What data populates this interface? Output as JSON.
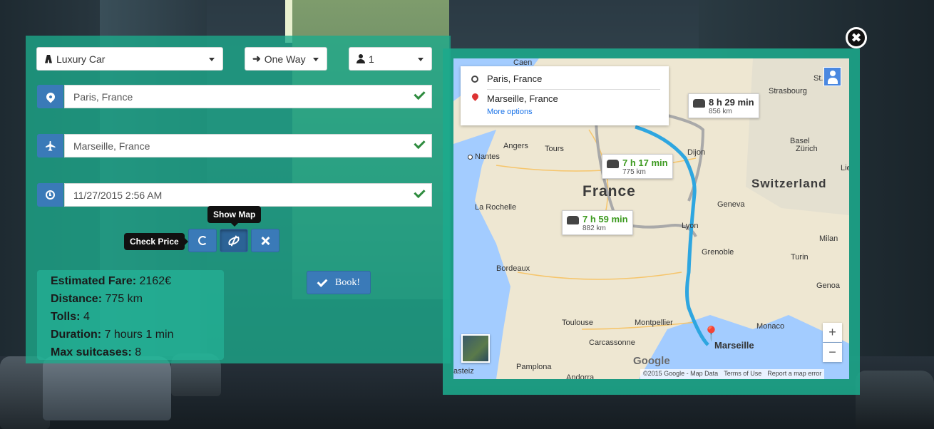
{
  "form": {
    "vehicle": "Luxury Car",
    "trip_type": "One Way",
    "passengers": "1",
    "pickup": "Paris, France",
    "dropoff": "Marseille, France",
    "datetime": "11/27/2015 2:56 AM"
  },
  "tooltips": {
    "show_map": "Show Map",
    "check_price": "Check Price"
  },
  "summary": {
    "fare_label": "Estimated Fare:",
    "fare_value": "2162€",
    "distance_label": "Distance:",
    "distance_value": "775 km",
    "tolls_label": "Tolls:",
    "tolls_value": "4",
    "duration_label": "Duration:",
    "duration_value": "7 hours 1 min",
    "suitcases_label": "Max suitcases:",
    "suitcases_value": "8"
  },
  "book_label": "Book!",
  "map": {
    "origin": "Paris, France",
    "destination": "Marseille, France",
    "more_options": "More options",
    "routes": [
      {
        "time": "8 h 29 min",
        "distance": "856 km"
      },
      {
        "time": "7 h 17 min",
        "distance": "775 km"
      },
      {
        "time": "7 h 59 min",
        "distance": "882 km"
      }
    ],
    "labels": {
      "country_france": "France",
      "country_switzerland": "Switzerland",
      "caen": "Caen",
      "strasbourg": "Strasbourg",
      "nantes": "Nantes",
      "angers": "Angers",
      "tours": "Tours",
      "dijon": "Dijon",
      "basel": "Basel",
      "zurich": "Zürich",
      "lie": "Lie",
      "la_rochelle": "La Rochelle",
      "geneva": "Geneva",
      "lyon": "Lyon",
      "milan": "Milan",
      "grenoble": "Grenoble",
      "turin": "Turin",
      "bordeaux": "Bordeaux",
      "genoa": "Genoa",
      "toulouse": "Toulouse",
      "montpellier": "Montpellier",
      "monaco": "Monaco",
      "carcassonne": "Carcassonne",
      "marseille": "Marseille",
      "pamplona": "Pamplona",
      "andorra": "Andorra",
      "vitoria": "asteiz",
      "st_gallen": "St. Gal"
    },
    "google": "Google",
    "attribution": [
      "©2015 Google - Map Data",
      "Terms of Use",
      "Report a map error"
    ]
  },
  "colors": {
    "panel": "#1caa8c",
    "button": "#3a7ab8",
    "route": "#2ea6e0",
    "check": "#2e8b3e"
  }
}
